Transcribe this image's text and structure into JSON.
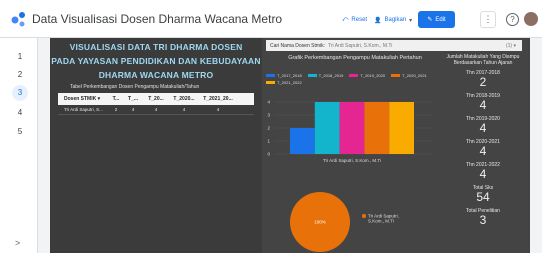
{
  "app": {
    "title": "Data Visualisasi Dosen Dharma Wacana Metro"
  },
  "toolbar": {
    "reset": "Reset",
    "share": "Bagikan",
    "edit": "Edit",
    "more": "⋮",
    "help": "?"
  },
  "pages": [
    "1",
    "2",
    "3",
    "4",
    "5"
  ],
  "left": {
    "title_lines": [
      "VISUALISASI DATA TRI DHARMA DOSEN",
      "PADA YAYASAN PENDIDIKAN DAN KEBUDAYAAN",
      "DHARMA WACANA METRO"
    ],
    "table_caption": "Tabel Perkembangan Dosen Pengampu Matakuliah/Tahun",
    "table": {
      "headers": [
        "Dosen STMIK ▾",
        "T...",
        "T_...",
        "T_20...",
        "T_2020...",
        "T_2021_20..."
      ],
      "rows": [
        [
          "Tri Ardi Saputri, S...",
          "2",
          "4",
          "4",
          "4",
          "4"
        ]
      ]
    }
  },
  "filter": {
    "label": "Cari Nama Dosen Stmik:",
    "value": "Tri Ardi Saputri, S.Kom., M.Ti",
    "all": "(1) ▾"
  },
  "chart_data": [
    {
      "type": "bar",
      "title": "Grafik Perkembangan Pengampu Matakuliah Pertahun",
      "categories": [
        "Tri Ardi Saputri, S.Kom., M.Ti"
      ],
      "series": [
        {
          "name": "T_2017_2018",
          "values": [
            2
          ]
        },
        {
          "name": "T_2018_2019",
          "values": [
            4
          ]
        },
        {
          "name": "T_2019_2020",
          "values": [
            4
          ]
        },
        {
          "name": "T_2020_2021",
          "values": [
            4
          ]
        },
        {
          "name": "T_2021_2022",
          "values": [
            4
          ]
        }
      ],
      "yticks": [
        "0",
        "1",
        "2",
        "3",
        "4"
      ],
      "ylim": [
        0,
        4
      ],
      "colors": [
        "#1a73e8",
        "#12b5cb",
        "#e52592",
        "#e8710a",
        "#f9ab00"
      ],
      "legend_position": "top"
    },
    {
      "type": "pie",
      "slices": [
        {
          "name": "Tri Ardi Saputri, S.Kom., M.Ti",
          "value": 100,
          "label": "100%"
        }
      ],
      "colors": [
        "#e8710a"
      ],
      "legend_position": "right"
    }
  ],
  "kpis": {
    "title": "Jumlah Matakuliah Yang Diampu Berdasarkan Tahun Ajaran",
    "items": [
      {
        "label": "Thn 2017-2018",
        "value": "2"
      },
      {
        "label": "Thn 2018-2019",
        "value": "4"
      },
      {
        "label": "Thn 2019-2020",
        "value": "4"
      },
      {
        "label": "Thn 2020-2021",
        "value": "4"
      },
      {
        "label": "Thn 2021-2022",
        "value": "4"
      },
      {
        "label": "Total Sks",
        "value": "54"
      },
      {
        "label": "Total Penelitian",
        "value": "3"
      }
    ]
  }
}
